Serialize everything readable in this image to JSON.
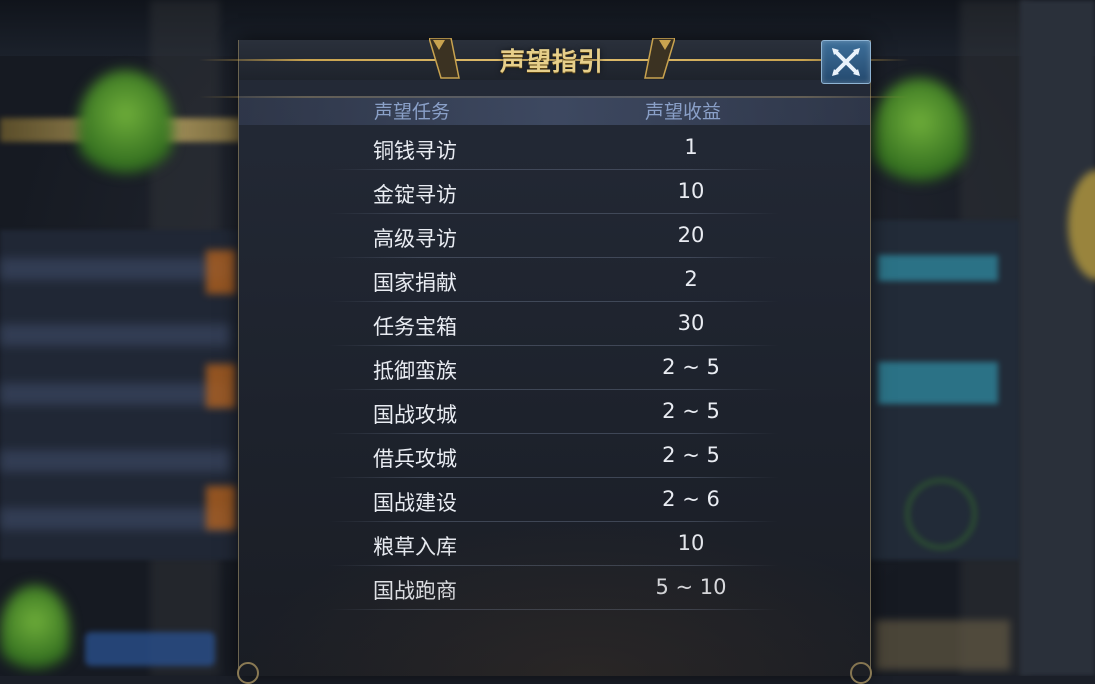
{
  "dialog": {
    "title": "声望指引",
    "close_icon": "close-x-icon",
    "headers": {
      "task": "声望任务",
      "reward": "声望收益"
    },
    "rows": [
      {
        "task": "铜钱寻访",
        "reward": "1"
      },
      {
        "task": "金锭寻访",
        "reward": "10"
      },
      {
        "task": "高级寻访",
        "reward": "20"
      },
      {
        "task": "国家捐献",
        "reward": "2"
      },
      {
        "task": "任务宝箱",
        "reward": "30"
      },
      {
        "task": "抵御蛮族",
        "reward": "2 ~ 5"
      },
      {
        "task": "国战攻城",
        "reward": "2 ~ 5"
      },
      {
        "task": "借兵攻城",
        "reward": "2 ~ 5"
      },
      {
        "task": "国战建设",
        "reward": "2 ~ 6"
      },
      {
        "task": "粮草入库",
        "reward": "10"
      },
      {
        "task": "国战跑商",
        "reward": "5 ~ 10"
      }
    ]
  },
  "colors": {
    "title_gold": "#e7cf8a",
    "header_text": "#8aa0c8",
    "row_text": "#e9ecf2",
    "close_button": "#2f5d86"
  }
}
